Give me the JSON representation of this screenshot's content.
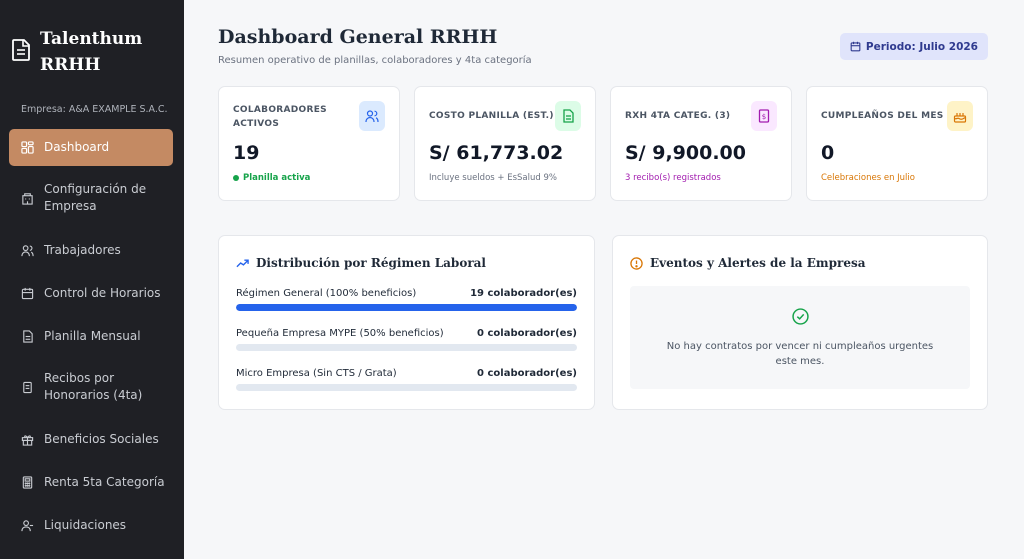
{
  "brand": {
    "title": "Talenthum RRHH"
  },
  "company": "Empresa: A&A EXAMPLE S.A.C.",
  "nav": [
    {
      "label": "Dashboard",
      "icon": "dashboard-icon",
      "active": true
    },
    {
      "label": "Configuración de Empresa",
      "icon": "building-icon"
    },
    {
      "label": "Trabajadores",
      "icon": "users-icon"
    },
    {
      "label": "Control de Horarios",
      "icon": "calendar-icon"
    },
    {
      "label": "Planilla Mensual",
      "icon": "document-icon"
    },
    {
      "label": "Recibos por Honorarios (4ta)",
      "icon": "receipt-icon"
    },
    {
      "label": "Beneficios Sociales",
      "icon": "gift-icon"
    },
    {
      "label": "Renta 5ta Categoría",
      "icon": "calculator-icon"
    },
    {
      "label": "Liquidaciones",
      "icon": "user-minus-icon"
    }
  ],
  "header": {
    "title": "Dashboard General RRHH",
    "subtitle": "Resumen operativo de planillas, colaboradores y 4ta categoría",
    "period": "Periodo: Julio 2026"
  },
  "stats": [
    {
      "label": "COLABORADORES ACTIVOS",
      "value": "19",
      "note": "Planilla activa",
      "icon": "users-icon",
      "accent": "#16a34a",
      "icon_bg": "#dbeafe",
      "icon_color": "#2563eb"
    },
    {
      "label": "COSTO PLANILLA (EST.)",
      "value": "S/ 61,773.02",
      "note": "Incluye sueldos + EsSalud 9%",
      "icon": "document-icon",
      "accent": "#6b7280",
      "icon_bg": "#dcfce7",
      "icon_color": "#16a34a"
    },
    {
      "label": "RXH 4TA CATEG. (3)",
      "value": "S/ 9,900.00",
      "note": "3 recibo(s) registrados",
      "icon": "receipt-icon",
      "accent": "#a21caf",
      "icon_bg": "#fae8ff",
      "icon_color": "#a21caf"
    },
    {
      "label": "CUMPLEAÑOS DEL MES",
      "value": "0",
      "note": "Celebraciones en Julio",
      "icon": "cake-icon",
      "accent": "#d97706",
      "icon_bg": "#fef3c7",
      "icon_color": "#d97706"
    }
  ],
  "distribution": {
    "title": "Distribución por Régimen Laboral",
    "items": [
      {
        "label": "Régimen General (100% beneficios)",
        "count": "19 colaborador(es)",
        "fraction": 1.0
      },
      {
        "label": "Pequeña Empresa MYPE (50% beneficios)",
        "count": "0 colaborador(es)",
        "fraction": 0
      },
      {
        "label": "Micro Empresa (Sin CTS / Grata)",
        "count": "0 colaborador(es)",
        "fraction": 0
      }
    ]
  },
  "alerts": {
    "title": "Eventos y Alertes de la Empresa",
    "empty_text": "No hay contratos por vencer ni cumpleaños urgentes este mes."
  }
}
